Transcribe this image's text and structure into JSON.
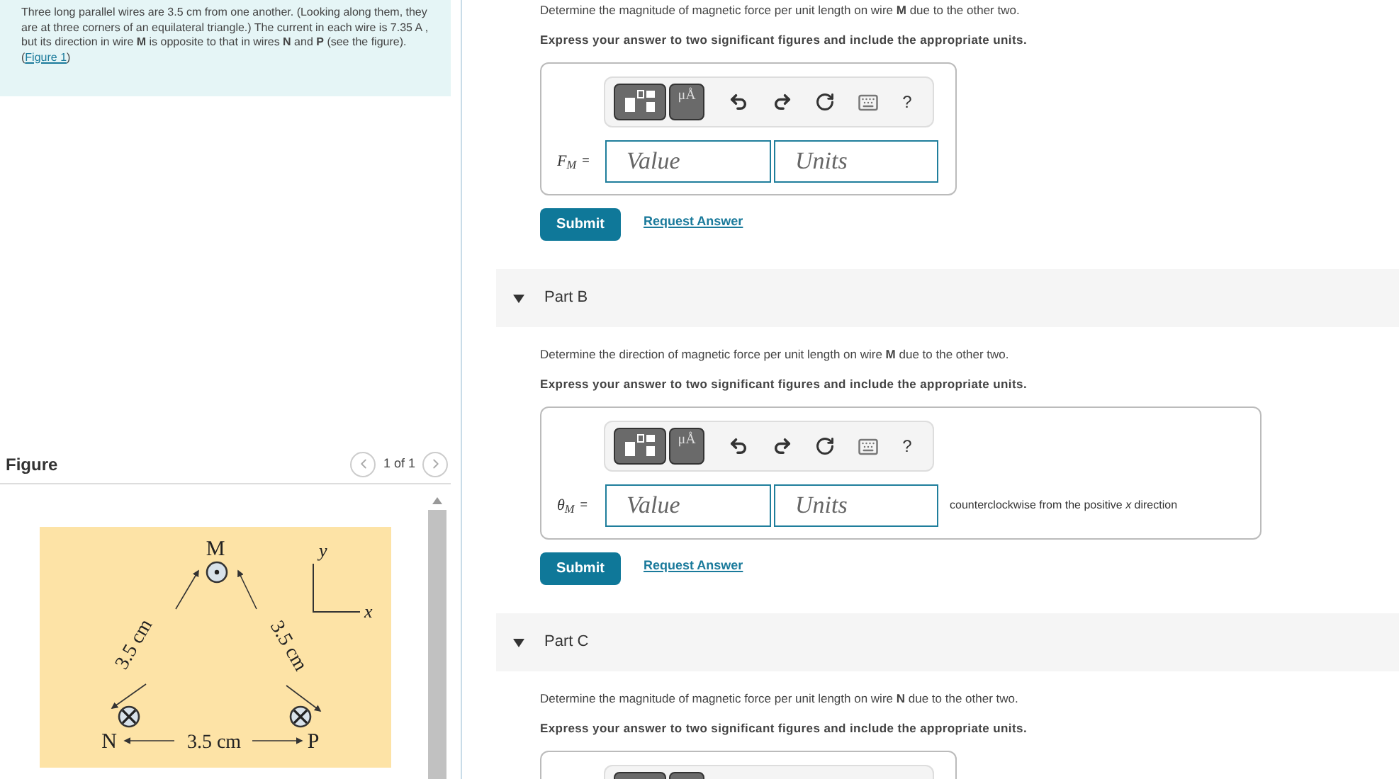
{
  "problem": {
    "text": "Three long parallel wires are 3.5 cm from one another. (Looking along them, they are at three corners of an equilateral triangle.) The current in each wire is 7.35 A , but its direction in wire **M** is opposite to that in wires **N** and **P** (see the figure).(",
    "link": "Figure 1",
    "text_end": ")"
  },
  "figure": {
    "title": "Figure",
    "pager": "1 of 1",
    "wires": [
      {
        "name": "M",
        "kind": "out"
      },
      {
        "name": "N",
        "kind": "in"
      },
      {
        "name": "P",
        "kind": "in"
      }
    ],
    "side_labels": [
      "3.5 cm",
      "3.5 cm",
      "3.5 cm"
    ],
    "axes": {
      "x": "x",
      "y": "y"
    }
  },
  "parts": [
    {
      "prompt": "Determine the magnitude of magnetic force per unit length on wire **M** due to the other two.",
      "instruction": "Express your answer to two significant figures and include the appropriate units.",
      "answer": {
        "symbol": "F",
        "subscript": "M",
        "equals": "=",
        "value_placeholder": "Value",
        "units_placeholder": "Units",
        "units_button": "μÅ",
        "help": "?"
      },
      "submit": "Submit",
      "request": "Request Answer"
    },
    {
      "label": "Part B",
      "expanded": true,
      "prompt": "Determine the direction of magnetic force per unit length on wire **M** due to the other two.",
      "instruction": "Express your answer to two significant figures and include the appropriate units.",
      "answer": {
        "symbol": "θ",
        "subscript": "M",
        "equals": "=",
        "value_placeholder": "Value",
        "units_placeholder": "Units",
        "suffix": "counterclockwise from the positive *x* direction",
        "units_button": "μÅ",
        "help": "?"
      },
      "submit": "Submit",
      "request": "Request Answer"
    },
    {
      "label": "Part C",
      "expanded": true,
      "prompt": "Determine the magnitude of magnetic force per unit length on wire **N** due to the other two.",
      "instruction": "Express your answer to two significant figures and include the appropriate units.",
      "answer": {
        "kind": "collapsed"
      }
    }
  ]
}
